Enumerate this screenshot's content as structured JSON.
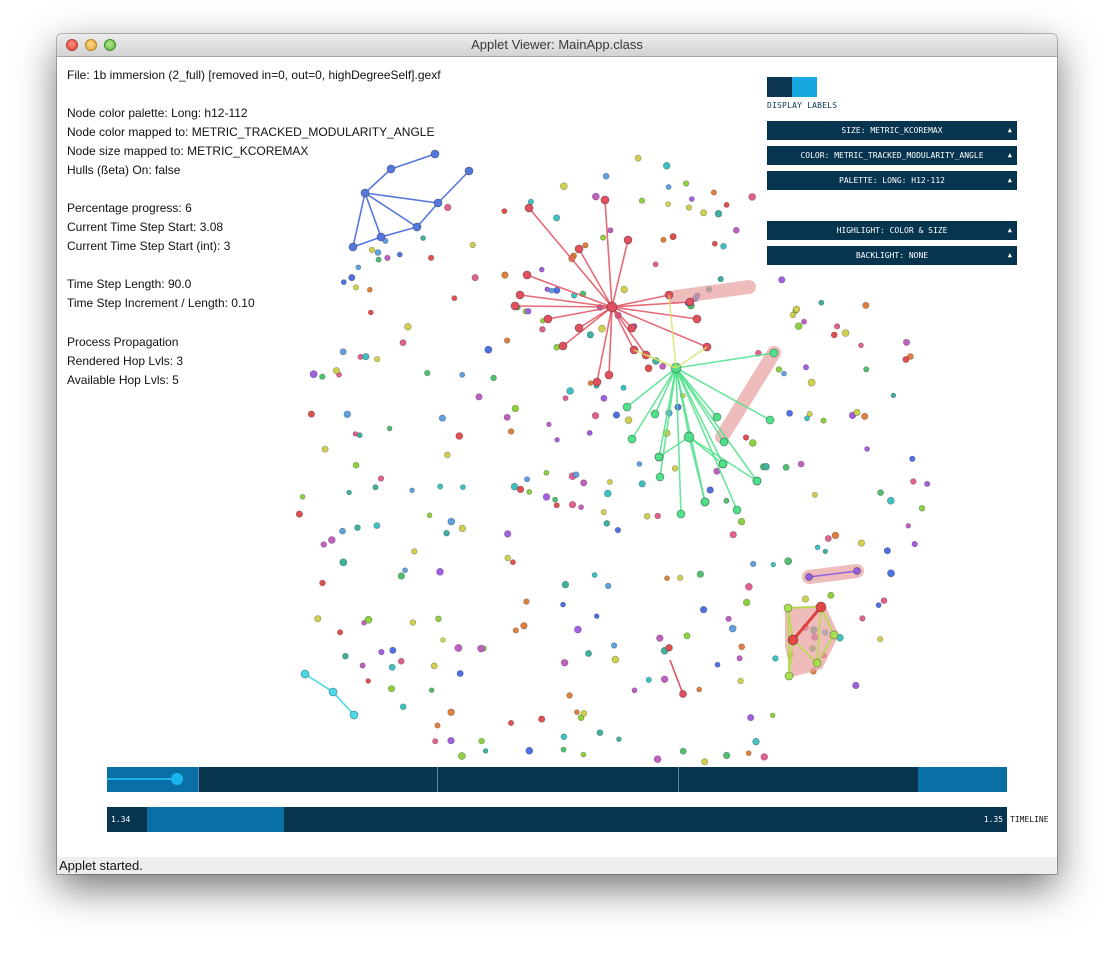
{
  "window": {
    "title": "Applet Viewer: MainApp.class"
  },
  "info": {
    "file": "File: 1b immersion (2_full) [removed in=0, out=0, highDegreeSelf].gexf",
    "palette": "Node color palette: Long: h12-112",
    "color_mapped": "Node color mapped to: METRIC_TRACKED_MODULARITY_ANGLE",
    "size_mapped": "Node size mapped to: METRIC_KCOREMAX",
    "hulls": "Hulls (ßeta) On: false",
    "progress": "Percentage progress: 6",
    "time_start": "Current Time Step Start: 3.08",
    "time_start_int": "Current Time Step Start (int): 3",
    "step_length": "Time Step Length: 90.0",
    "step_increment": "Time Step Increment / Length: 0.10",
    "process": "Process Propagation",
    "rendered_hops": "Rendered Hop Lvls: 3",
    "available_hops": "Available Hop Lvls: 5"
  },
  "controls": {
    "display_labels": "DISPLAY LABELS",
    "size": "SIZE: METRIC_KCOREMAX",
    "color": "COLOR: METRIC_TRACKED_MODULARITY_ANGLE",
    "palette": "PALETTE: LONG: H12-112",
    "highlight": "HIGHLIGHT: COLOR & SIZE",
    "backlight": "BACKLIGHT: NONE",
    "caret": "▲"
  },
  "timeline": {
    "start": "1.34",
    "end": "1.35",
    "label": "TIMELINE"
  },
  "status": "Applet started.",
  "colors": {
    "panel": "#07344f",
    "accent": "#18a7e0",
    "red_cluster": "#e0505e",
    "green_cluster": "#4fe08a",
    "blue_cluster": "#5577dd",
    "cyan_cluster": "#4ad8e8",
    "hull": "#e8a0a0"
  }
}
